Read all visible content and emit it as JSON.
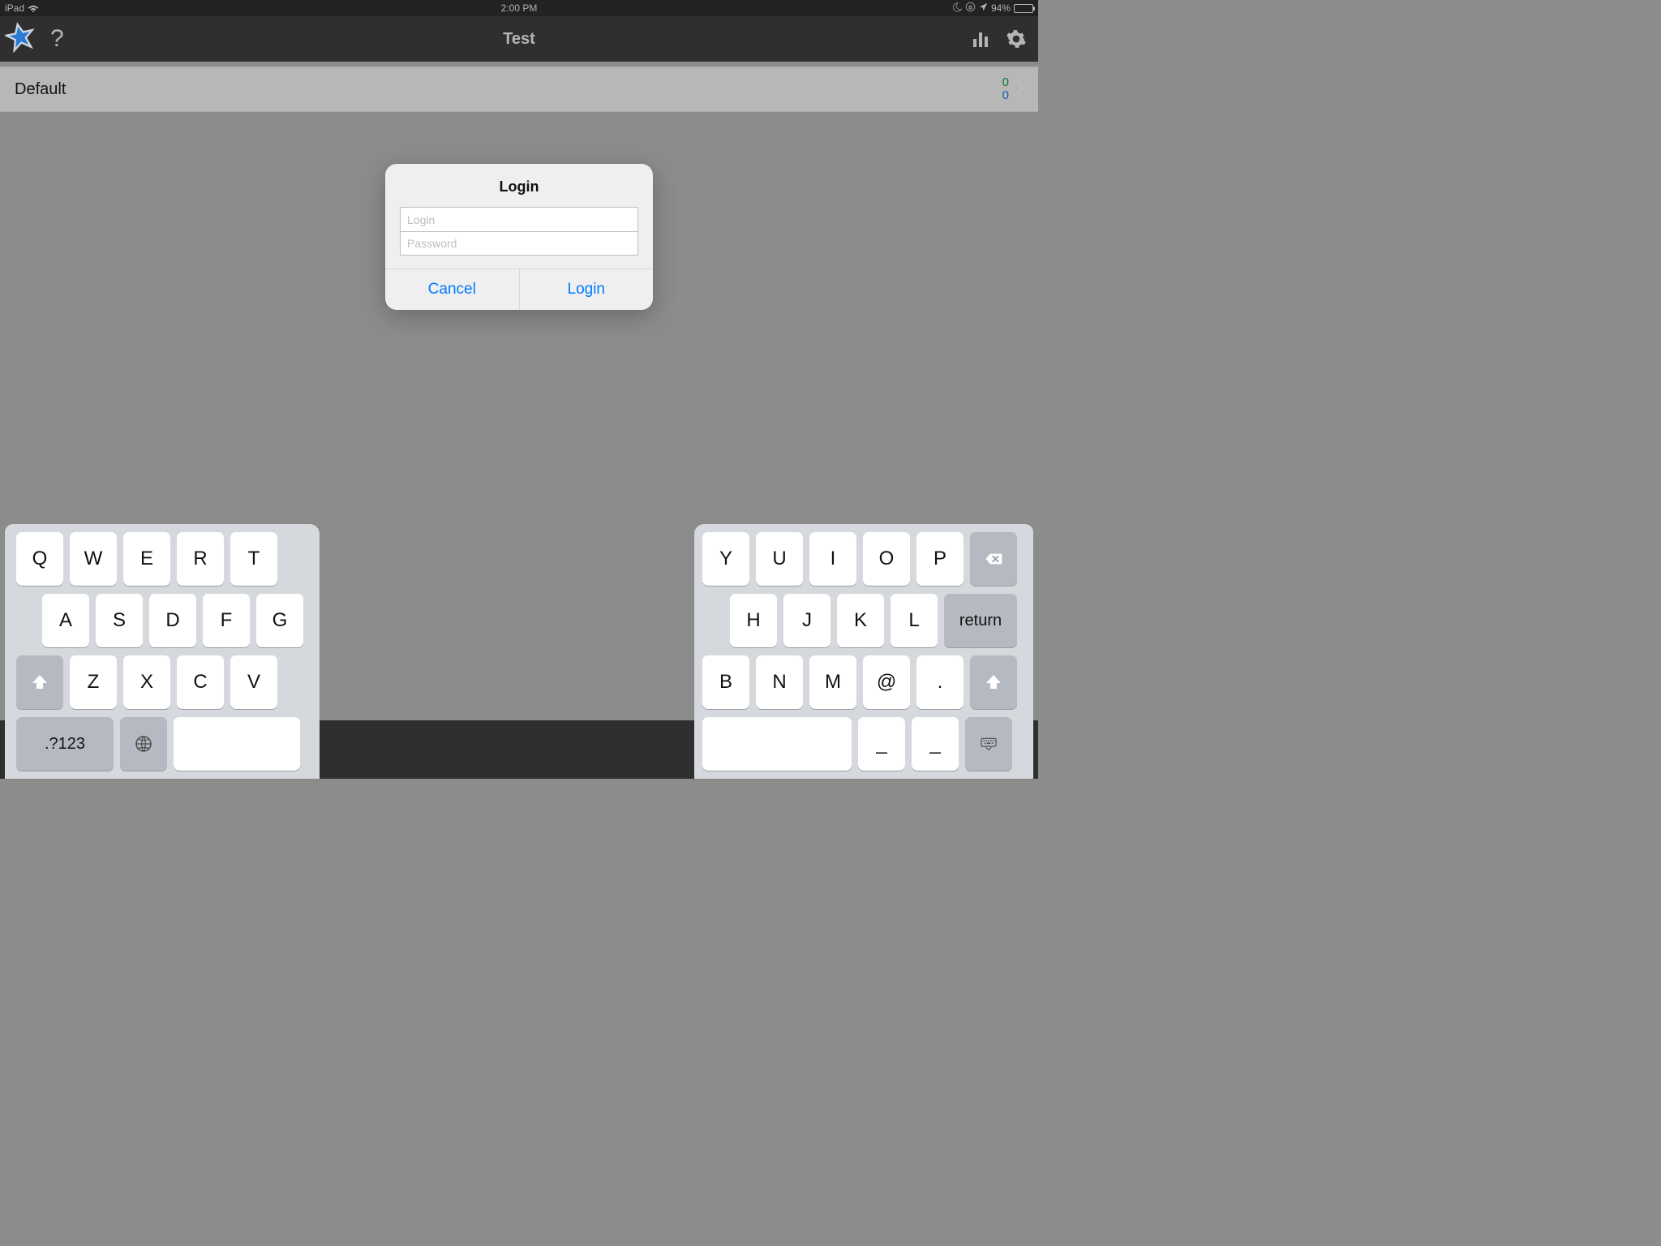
{
  "status": {
    "device": "iPad",
    "time": "2:00 PM",
    "battery_pct": "94%"
  },
  "nav": {
    "title": "Test"
  },
  "list": {
    "row0": {
      "label": "Default",
      "count_green": "0",
      "count_blue": "0"
    }
  },
  "alert": {
    "title": "Login",
    "login_placeholder": "Login",
    "password_placeholder": "Password",
    "cancel": "Cancel",
    "login_action": "Login"
  },
  "keyboard": {
    "left": {
      "r1": [
        "Q",
        "W",
        "E",
        "R",
        "T"
      ],
      "r2": [
        "A",
        "S",
        "D",
        "F",
        "G"
      ],
      "r3": [
        "Z",
        "X",
        "C",
        "V"
      ],
      "mode_label": ".?123"
    },
    "right": {
      "r1": [
        "Y",
        "U",
        "I",
        "O",
        "P"
      ],
      "r2": [
        "H",
        "J",
        "K",
        "L"
      ],
      "r3": [
        "B",
        "N",
        "M",
        "@",
        "."
      ],
      "r4": [
        "_",
        "_"
      ],
      "return_label": "return"
    }
  }
}
